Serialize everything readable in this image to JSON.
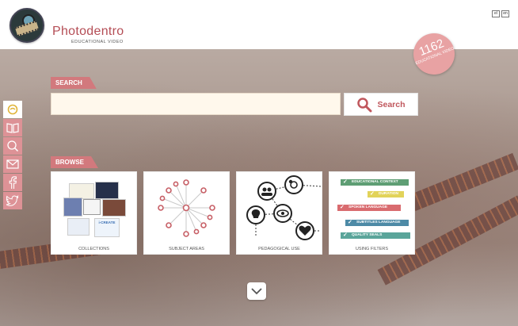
{
  "header": {
    "brand": "Photodentro",
    "brand_sub": "EDUCATIONAL VIDEO",
    "lang_el": "el",
    "lang_en": "en"
  },
  "badge": {
    "count": "1162",
    "label": "EDUCATIONAL VIDEO"
  },
  "search": {
    "section_label": "SEARCH",
    "input_value": "",
    "input_placeholder": "",
    "button_label": "Search"
  },
  "social_icons": [
    "photodentro-icon",
    "book-icon",
    "search-help-icon",
    "mail-icon",
    "facebook-icon",
    "twitter-icon"
  ],
  "browse": {
    "section_label": "BROWSE",
    "cards": [
      {
        "label": "COLLECTIONS",
        "thumb_text": "i-CREATE"
      },
      {
        "label": "SUBJECT AREAS"
      },
      {
        "label": "PEDAGOGICAL USE"
      },
      {
        "label": "USING FILTERS",
        "filters": [
          {
            "text": "EDUCATIONAL CONTEXT",
            "color": "#5e9e74"
          },
          {
            "text": "DURATION",
            "color": "#e2d35a"
          },
          {
            "text": "SPOKEN LANGUAGE",
            "color": "#d96b6f"
          },
          {
            "text": "SUBTITLES LANGUAGE",
            "color": "#4d8aa6"
          },
          {
            "text": "QUALITY SEALS",
            "color": "#5aa59a"
          }
        ]
      }
    ]
  },
  "colors": {
    "accent": "#d2797d",
    "brand": "#b44d55",
    "badge": "#e8a2a3"
  }
}
